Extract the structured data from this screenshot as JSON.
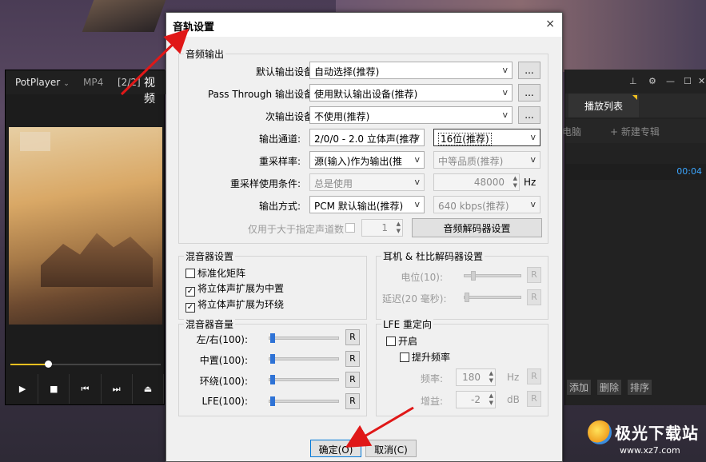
{
  "player": {
    "brand": "PotPlayer",
    "format": "MP4",
    "index": "[2/2]",
    "video_title": "视频",
    "controls": [
      "▶",
      "■",
      "⏮",
      "⏭",
      "⏏"
    ],
    "progress": 0.25
  },
  "playlist": {
    "tab": "播放列表",
    "items": [
      "电脑",
      "+ 新建专辑"
    ],
    "time": "00:04",
    "buttons": [
      "添加",
      "删除",
      "排序"
    ]
  },
  "dialog": {
    "title": "音轨设置",
    "close": "×",
    "audio_output": {
      "group": "音频输出",
      "default_device_label": "默认输出设备:",
      "default_device": "自动选择(推荐)",
      "passthrough_label": "Pass Through 输出设备:",
      "passthrough": "使用默认输出设备(推荐)",
      "secondary_label": "次输出设备:",
      "secondary": "不使用(推荐)",
      "browse": "...",
      "channel_label": "输出通道:",
      "channel": "2/0/0 - 2.0 立体声(推荐",
      "bits": "16位(推荐)",
      "resample_label": "重采样率:",
      "resample": "源(输入)作为输出(推",
      "quality": "中等品质(推荐)",
      "resample_cond_label": "重采样使用条件:",
      "resample_cond": "总是使用",
      "hz_value": "48000",
      "hz_unit": "Hz",
      "output_mode_label": "输出方式:",
      "output_mode": "PCM 默认输出(推荐)",
      "bitrate": "640 kbps(推荐)",
      "only_label": "仅用于大于指定声道数",
      "only_value": "1",
      "decoder_button": "音频解码器设置"
    },
    "mixer": {
      "group": "混音器设置",
      "normalize": "标准化矩阵",
      "center": "将立体声扩展为中置",
      "surround": "将立体声扩展为环绕"
    },
    "headphone": {
      "group": "耳机 & 杜比解码器设置",
      "level": "电位(10):",
      "delay": "延迟(20 毫秒):",
      "reset": "R"
    },
    "mixer_volume": {
      "group": "混音器音量",
      "lr": "左/右(100):",
      "center": "中置(100):",
      "surround": "环绕(100):",
      "lfe": "LFE(100):",
      "reset": "R"
    },
    "lfe": {
      "group": "LFE 重定向",
      "enable": "开启",
      "boost": "提升频率",
      "freq_label": "频率:",
      "freq": "180",
      "freq_unit": "Hz",
      "gain_label": "增益:",
      "gain": "-2",
      "gain_unit": "dB",
      "reset": "R"
    },
    "ok": "确定(O)",
    "cancel": "取消(C)"
  },
  "watermark": {
    "title": "极光下载站",
    "url": "www.xz7.com"
  },
  "colors": {
    "annotation_arrow": "#e01818",
    "slider_thumb": "#2f73d6",
    "accent": "#f0c020"
  }
}
